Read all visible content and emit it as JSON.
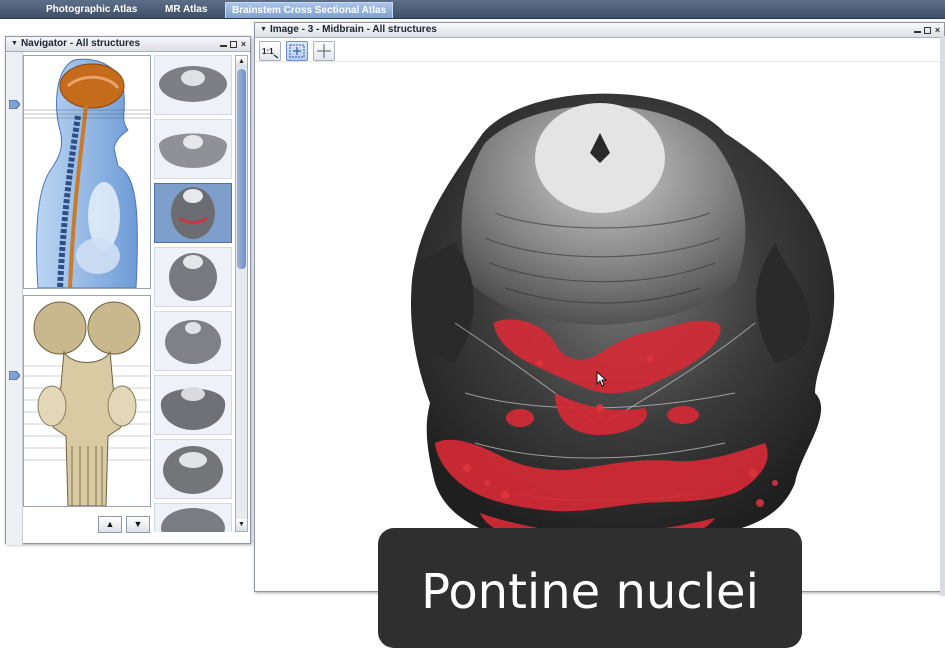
{
  "tabs": [
    {
      "label": "Photographic Atlas",
      "active": false
    },
    {
      "label": "MR Atlas",
      "active": false
    },
    {
      "label": "Brainstem Cross Sectional Atlas",
      "active": true
    }
  ],
  "navigator": {
    "title": "Navigator - All structures",
    "selected_thumbnail_index": 2,
    "thumbnail_count": 8,
    "up_arrow": "▲",
    "down_arrow": "▼",
    "scroll_up": "▲",
    "scroll_down": "▼"
  },
  "image_panel": {
    "title": "Image - 3 - Midbrain - All structures",
    "tools": [
      "zoom-1-to-1-icon",
      "fit-to-window-icon",
      "crosshair-icon"
    ],
    "tool_zoom_label": "1:1",
    "highlighted_structure_color": "#d42a36"
  },
  "caption": "Pontine nuclei",
  "colors": {
    "tabbar": "#4b5c77",
    "active_tab": "#8eaed9",
    "selected_thumb": "#7e9ecc",
    "highlight": "#d42a36"
  }
}
